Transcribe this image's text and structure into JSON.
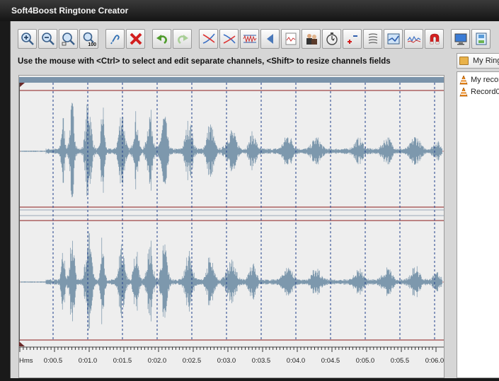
{
  "window": {
    "title": "Soft4Boost Ringtone Creator"
  },
  "toolbar": {
    "buttons": [
      {
        "name": "zoom-in-button",
        "icon": "zoom-in-icon",
        "tooltip": "Zoom in"
      },
      {
        "name": "zoom-out-button",
        "icon": "zoom-out-icon",
        "tooltip": "Zoom out"
      },
      {
        "name": "zoom-fit-button",
        "icon": "zoom-fit-icon",
        "tooltip": "Zoom to fit"
      },
      {
        "name": "zoom-100-button",
        "icon": "zoom-100-icon",
        "tooltip": "Zoom 100%",
        "text": "100"
      },
      {
        "name": "link-button",
        "icon": "link-icon",
        "tooltip": "Link"
      },
      {
        "name": "delete-button",
        "icon": "delete-x-icon",
        "tooltip": "Delete"
      },
      {
        "name": "undo-button",
        "icon": "undo-icon",
        "tooltip": "Undo"
      },
      {
        "name": "redo-button",
        "icon": "redo-icon",
        "tooltip": "Redo"
      },
      {
        "name": "fade-in-button",
        "icon": "fade-in-icon",
        "tooltip": "Fade in"
      },
      {
        "name": "fade-out-button",
        "icon": "fade-out-icon",
        "tooltip": "Fade out"
      },
      {
        "name": "normalize-button",
        "icon": "normalize-icon",
        "tooltip": "Normalize"
      },
      {
        "name": "reverse-button",
        "icon": "reverse-icon",
        "tooltip": "Reverse"
      },
      {
        "name": "silence-button",
        "icon": "silence-icon",
        "tooltip": "Silence"
      },
      {
        "name": "voice-button",
        "icon": "people-icon",
        "tooltip": "Voice"
      },
      {
        "name": "tempo-button",
        "icon": "stopwatch-icon",
        "tooltip": "Tempo"
      },
      {
        "name": "volume-button",
        "icon": "plus-minus-icon",
        "tooltip": "Volume"
      },
      {
        "name": "echo-button",
        "icon": "echo-icon",
        "tooltip": "Echo"
      },
      {
        "name": "compress-button",
        "icon": "compress-icon",
        "tooltip": "Compressor"
      },
      {
        "name": "equalizer-button",
        "icon": "equalizer-icon",
        "tooltip": "Equalizer"
      },
      {
        "name": "magnet-button",
        "icon": "magnet-icon",
        "tooltip": "Magnet"
      },
      {
        "name": "computer-button",
        "icon": "computer-icon",
        "tooltip": "Computer"
      },
      {
        "name": "save-device-button",
        "icon": "save-device-icon",
        "tooltip": "Save to device"
      }
    ]
  },
  "hint": {
    "text": "Use the mouse with <Ctrl> to select and edit separate channels, <Shift> to resize channels fields"
  },
  "timeline": {
    "unit_label": "Hms",
    "labels": [
      "0:00.5",
      "0:01.0",
      "0:01.5",
      "0:02.0",
      "0:02.5",
      "0:03.0",
      "0:03.5",
      "0:04.0",
      "0:04.5",
      "0:05.0",
      "0:05.5",
      "0:06.0"
    ]
  },
  "playlist": {
    "folder_label": "My Ringt",
    "items": [
      "My recor",
      "Record0"
    ]
  },
  "colors": {
    "waveform": "#7d98ad",
    "gridline": "#1f3f8a",
    "redline": "#8b1a1a",
    "header_bar": "#7a93aa"
  }
}
